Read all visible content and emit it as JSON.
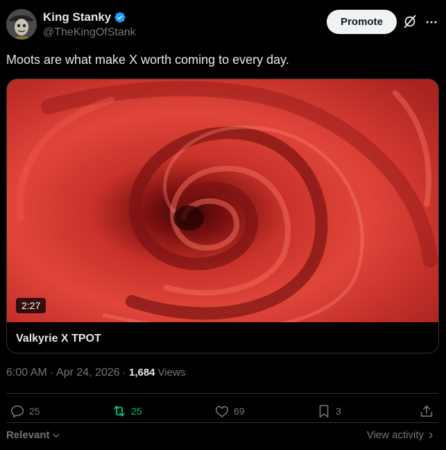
{
  "user": {
    "display_name": "King Stanky",
    "handle": "@TheKingOfStank"
  },
  "header": {
    "promote_label": "Promote"
  },
  "tweet": {
    "text": "Moots are what make X worth coming to every day."
  },
  "card": {
    "duration": "2:27",
    "title": "Valkyrie X TPOT"
  },
  "meta": {
    "time": "6:00 AM",
    "separator": "·",
    "date": "Apr 24, 2026",
    "separator2": "·",
    "views_count": "1,684",
    "views_label": "Views"
  },
  "actions": {
    "replies": "25",
    "reposts": "25",
    "likes": "69",
    "bookmarks": "3"
  },
  "footer": {
    "sort_label": "Relevant",
    "view_activity_label": "View activity"
  },
  "colors": {
    "background": "#000000",
    "text": "#e7e9ea",
    "muted": "#71767b",
    "verified": "#1d9bf0",
    "repost_active": "#00ba7c"
  }
}
